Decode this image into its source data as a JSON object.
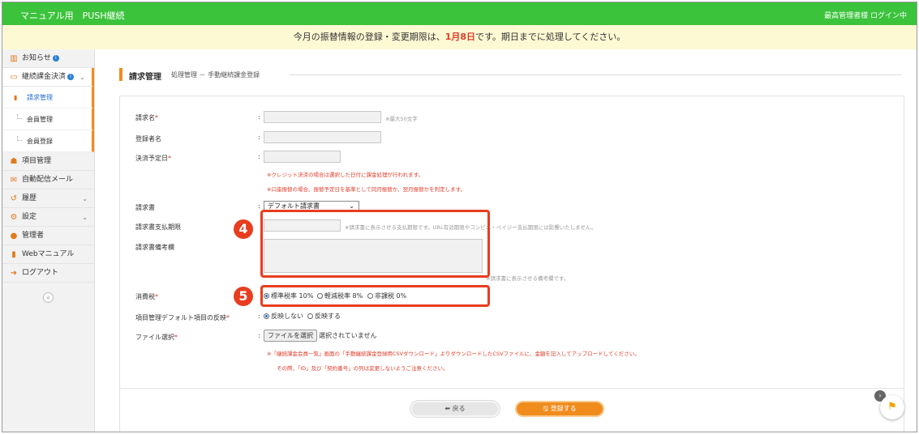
{
  "topbar": {
    "title": "マニュアル用　PUSH継続",
    "user_status": "最高管理者様 ログイン中"
  },
  "notice": {
    "prefix": "今月の振替情報の登録・変更期限は、",
    "deadline": "1月8日",
    "suffix": "です。期日までに処理してください。"
  },
  "sidebar": {
    "items": [
      {
        "label": "お知らせ",
        "icon": "chart-icon",
        "info": "i"
      },
      {
        "label": "継続課金決済",
        "icon": "card-icon",
        "info": "i"
      },
      {
        "label": "項目管理",
        "icon": "group-icon"
      },
      {
        "label": "自動配信メール",
        "icon": "mail-icon"
      },
      {
        "label": "履歴",
        "icon": "history-icon"
      },
      {
        "label": "設定",
        "icon": "gear-icon"
      },
      {
        "label": "管理者",
        "icon": "user-icon"
      },
      {
        "label": "Webマニュアル",
        "icon": "book-icon"
      },
      {
        "label": "ログアウト",
        "icon": "logout-icon"
      }
    ],
    "sub_items": [
      {
        "label": "請求管理"
      },
      {
        "label": "会員管理"
      },
      {
        "label": "会員登録"
      }
    ],
    "collapse": "«"
  },
  "page": {
    "title": "請求管理",
    "breadcrumb": "処理管理 － 手動継続課金登録"
  },
  "form": {
    "billing_name": {
      "label": "請求名",
      "req": "*",
      "hint": "※最大50文字"
    },
    "registrant": {
      "label": "登録者名"
    },
    "settlement_date": {
      "label": "決済予定日",
      "req": "*",
      "note1": "※クレジット決済の場合は選択した日付に課金処理が行われます。",
      "note2": "※口座振替の場合、振替予定日を基準として同月振替か、翌月振替かを判定します。"
    },
    "invoice": {
      "label": "請求書",
      "value": "デフォルト請求書"
    },
    "invoice_due": {
      "label": "請求書支払期限",
      "hint": "※請求書に表示させる支払期限です。URL有効期限やコンビニ・ペイジー支払期限には影響いたしません。"
    },
    "invoice_note": {
      "label": "請求書備考欄",
      "hint": "※請求書に表示させる備考欄です。"
    },
    "tax": {
      "label": "消費税",
      "req": "*",
      "opt1": "標準税率 10%",
      "opt2": "軽減税率 8%",
      "opt3": "非課税 0%"
    },
    "reflect": {
      "label": "項目管理デフォルト項目の反映",
      "req": "*",
      "opt1": "反映しない",
      "opt2": "反映する"
    },
    "file": {
      "label": "ファイル選択",
      "req": "*",
      "button": "ファイルを選択",
      "status": "選択されていません",
      "note1": "※「継続課金会員一覧」画面の「手動継続課金登録用CSVダウンロード」よりダウンロードしたCSVファイルに、金額を記入してアップロードしてください。",
      "note2": "その際、「ID」及び「契約番号」の列は変更しないようご注意ください。"
    },
    "colon": ":"
  },
  "buttons": {
    "back": "⬅ 戻る",
    "save": "🖫 登録する"
  },
  "callouts": {
    "four": "4",
    "five": "5"
  },
  "colors": {
    "topbar": "#3cc33c",
    "accent": "#f08c1e",
    "highlight": "#e83d1e",
    "required": "#e03c2a"
  }
}
